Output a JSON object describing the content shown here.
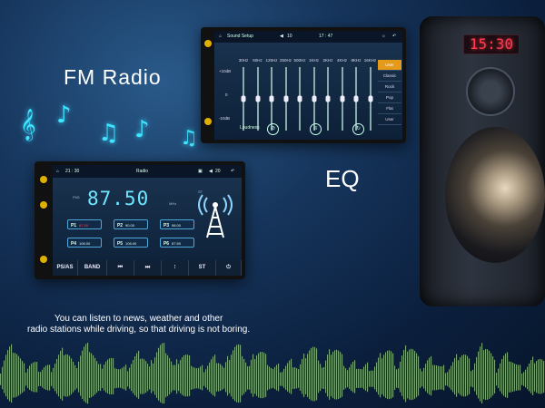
{
  "titles": {
    "fm": "FM Radio",
    "eq": "EQ"
  },
  "speaker": {
    "display": "15:30"
  },
  "eq_screen": {
    "title": "Sound Setup",
    "volume": "10",
    "time": "17 : 47",
    "frequencies": [
      "30Hz",
      "60Hz",
      "125Hz",
      "250Hz",
      "500Hz",
      "1KHz",
      "2KHz",
      "4KHz",
      "8KHz",
      "16KHz"
    ],
    "slider_levels": [
      0.5,
      0.5,
      0.5,
      0.5,
      0.5,
      0.5,
      0.5,
      0.5,
      0.5,
      0.5
    ],
    "scale_top": "+10dB",
    "scale_mid": "0",
    "scale_bottom": "-10dB",
    "presets": [
      "User",
      "Classic",
      "Rock",
      "Pop",
      "Flat",
      "User"
    ],
    "active_preset_index": 0,
    "loudness_label": "Loudness"
  },
  "radio_screen": {
    "time": "21 : 30",
    "title": "Radio",
    "volume": "20",
    "band": "FM1",
    "frequency": "87.50",
    "unit": "MHz",
    "st": "ST",
    "presets": [
      {
        "label": "P1",
        "value": "87.50",
        "active": true
      },
      {
        "label": "P2",
        "value": "90.00",
        "active": false
      },
      {
        "label": "P3",
        "value": "98.00",
        "active": false
      },
      {
        "label": "P4",
        "value": "106.00",
        "active": false
      },
      {
        "label": "P5",
        "value": "108.00",
        "active": false
      },
      {
        "label": "P6",
        "value": "87.50",
        "active": false
      }
    ],
    "buttons": [
      "PS/AS",
      "BAND",
      "⏮",
      "⏭",
      "EQ",
      "ST",
      ""
    ]
  },
  "caption": {
    "line1": "You can listen to news, weather and other",
    "line2": "radio stations while driving, so that driving is not boring."
  },
  "colors": {
    "accent": "#3ee6ff",
    "preset_active": "#e59a1a",
    "freq": "#6fe6ff"
  }
}
